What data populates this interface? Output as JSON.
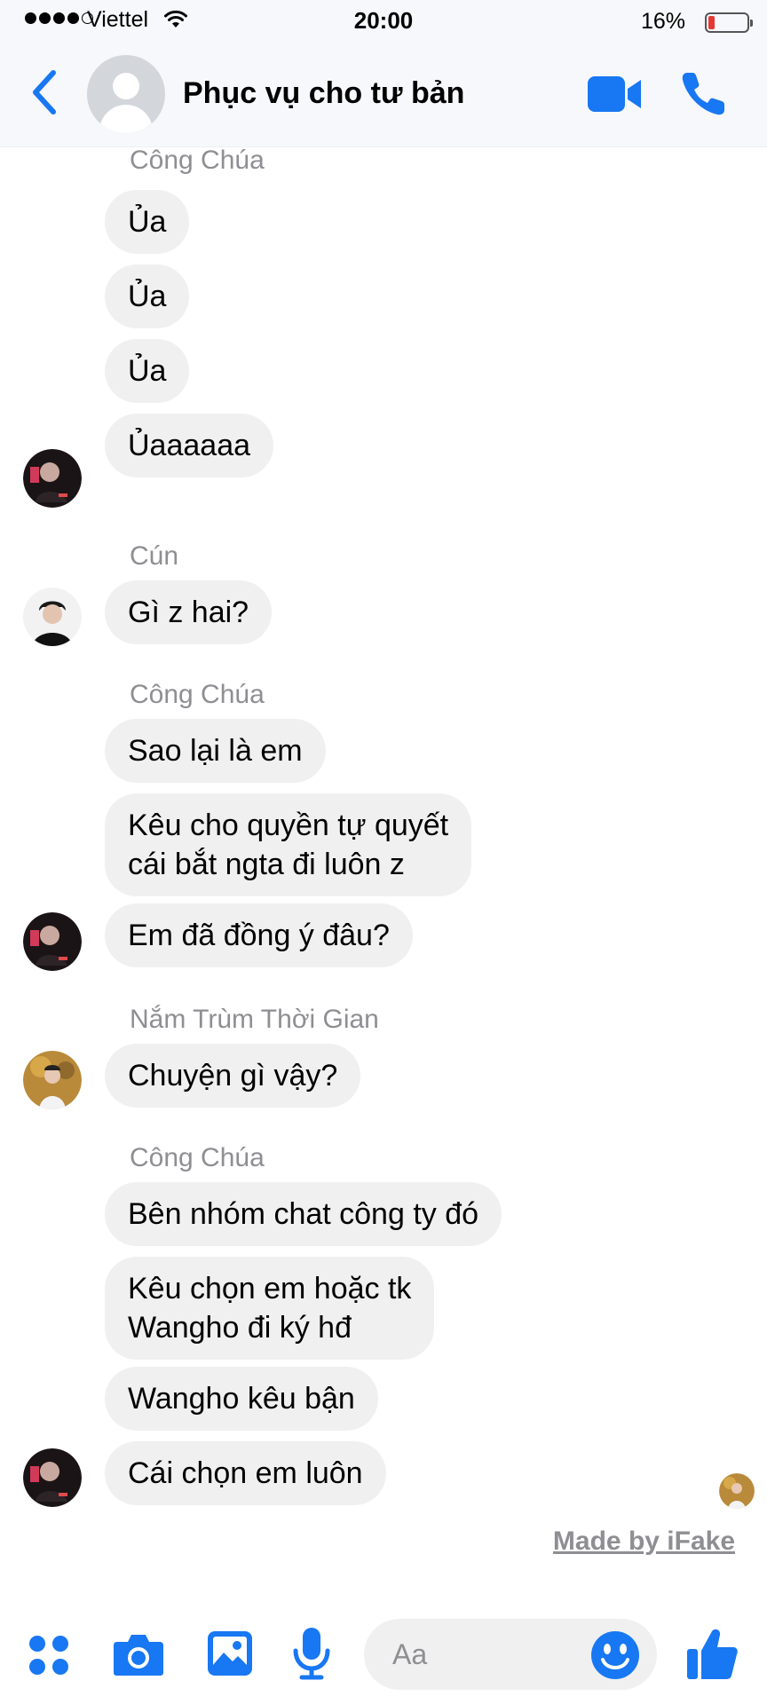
{
  "status_bar": {
    "carrier": "Viettel",
    "time": "20:00",
    "battery": "16%",
    "battery_level": 0.16
  },
  "header": {
    "title": "Phục vụ cho tư bản",
    "icons": [
      "back-icon",
      "group-avatar",
      "video-call-icon",
      "phone-icon"
    ]
  },
  "messages": [
    {
      "sender": "Công Chúa",
      "texts": [
        "Ủa",
        "Ủa",
        "Ủa",
        "Ủaaaaaa"
      ]
    },
    {
      "sender": "Cún",
      "texts": [
        "Gì z hai?"
      ]
    },
    {
      "sender": "Công Chúa",
      "texts": [
        "Sao lại là em",
        "Kêu cho quyền tự quyết\ncái bắt ngta đi luôn z",
        "Em đã đồng ý đâu?"
      ]
    },
    {
      "sender": "Nắm Trùm Thời Gian",
      "texts": [
        "Chuyện gì vậy?"
      ]
    },
    {
      "sender": "Công Chúa",
      "texts": [
        "Bên nhóm chat công ty đó",
        "Kêu chọn em hoặc tk\nWangho đi ký hđ",
        "Wangho kêu bận",
        "Cái chọn em luôn"
      ]
    }
  ],
  "watermark": "Made by iFake",
  "composer": {
    "placeholder": "Aa",
    "icons": [
      "more-icon",
      "camera-icon",
      "gallery-icon",
      "microphone-icon",
      "emoji-icon",
      "like-icon"
    ]
  },
  "colors": {
    "accent": "#1877f2",
    "bubble": "#f0f0f0",
    "header_bg": "#f7f8fb",
    "muted_text": "#8e8e93",
    "battery_low": "#e53935"
  }
}
